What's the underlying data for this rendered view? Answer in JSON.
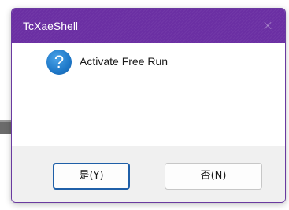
{
  "window": {
    "title": "TcXaeShell"
  },
  "dialog": {
    "icon": "question-icon",
    "icon_glyph": "?",
    "message": "Activate Free Run",
    "buttons": {
      "yes_label": "是(Y)",
      "no_label": "否(N)"
    }
  },
  "colors": {
    "titlebar": "#6b2fa3",
    "footer": "#f0f0f0",
    "accent_border": "#1f5fa8",
    "icon_blue": "#1e78c8"
  }
}
